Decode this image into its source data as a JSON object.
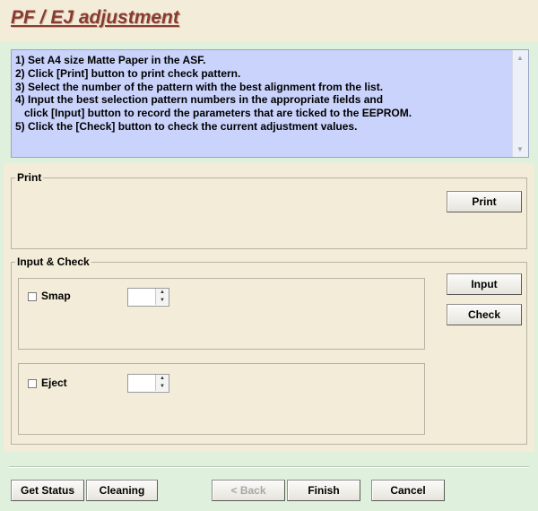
{
  "title": "PF / EJ adjustment",
  "instructions": [
    "1) Set A4 size Matte Paper in the ASF.",
    "2) Click [Print] button to print check pattern.",
    "3) Select the number of the pattern with the best alignment from the list.",
    "4) Input the best selection pattern numbers in the appropriate fields and",
    "   click [Input] button to record the parameters that are ticked to the EEPROM.",
    "5) Click the [Check] button to check the current adjustment values."
  ],
  "print_group": {
    "legend": "Print",
    "print_button": "Print"
  },
  "input_check_group": {
    "legend": "Input & Check",
    "smap": {
      "label": "Smap",
      "checked": false,
      "value": ""
    },
    "eject": {
      "label": "Eject",
      "checked": false,
      "value": ""
    },
    "input_button": "Input",
    "check_button": "Check"
  },
  "footer": {
    "get_status": "Get Status",
    "cleaning": "Cleaning",
    "back": "< Back",
    "finish": "Finish",
    "cancel": "Cancel"
  },
  "colors": {
    "window_background": "#dff0dc",
    "panel_background": "#f3ecd8",
    "instructions_background": "#c9d3fb",
    "title_color": "#8a3a32"
  }
}
